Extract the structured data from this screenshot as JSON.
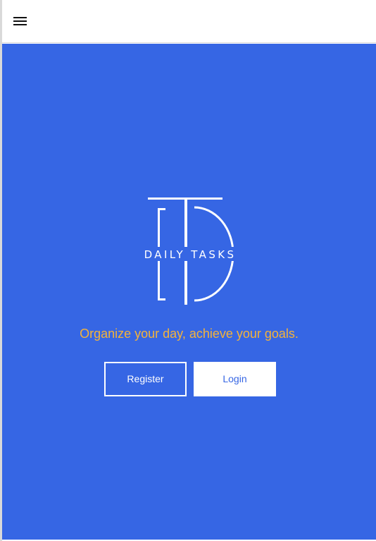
{
  "header": {
    "menu_icon": "hamburger-menu-icon"
  },
  "hero": {
    "logo": {
      "monogram": "TD",
      "wordmark": "DAILY TASKS"
    },
    "tagline": "Organize your day, achieve your goals.",
    "register_label": "Register",
    "login_label": "Login"
  },
  "colors": {
    "hero_background": "#3666e4",
    "tagline": "#f4b33a",
    "button_light": "#ffffff"
  }
}
